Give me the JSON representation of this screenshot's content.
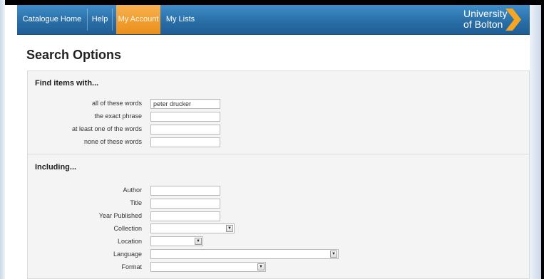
{
  "nav": {
    "items": [
      {
        "label": "Catalogue Home"
      },
      {
        "label": "Help"
      },
      {
        "label": "My Account",
        "active": true
      },
      {
        "label": "My Lists"
      }
    ]
  },
  "logo": {
    "line1": "University",
    "line2": "of Bolton"
  },
  "colors": {
    "nav_blue": "#2a6fa8",
    "active_orange": "#ea8f1b",
    "logo_chevron": "#f5a623"
  },
  "page_title": "Search Options",
  "find_items": {
    "heading": "Find items with...",
    "fields": [
      {
        "label": "all of these words",
        "value": "peter drucker"
      },
      {
        "label": "the exact phrase",
        "value": ""
      },
      {
        "label": "at least one of the words",
        "value": ""
      },
      {
        "label": "none of these words",
        "value": ""
      }
    ]
  },
  "including": {
    "heading": "Including...",
    "text_fields": [
      {
        "label": "Author",
        "value": ""
      },
      {
        "label": "Title",
        "value": ""
      },
      {
        "label": "Year Published",
        "value": ""
      }
    ],
    "select_fields": [
      {
        "label": "Collection",
        "value": ""
      },
      {
        "label": "Location",
        "value": ""
      },
      {
        "label": "Language",
        "value": ""
      },
      {
        "label": "Format",
        "value": ""
      }
    ]
  }
}
